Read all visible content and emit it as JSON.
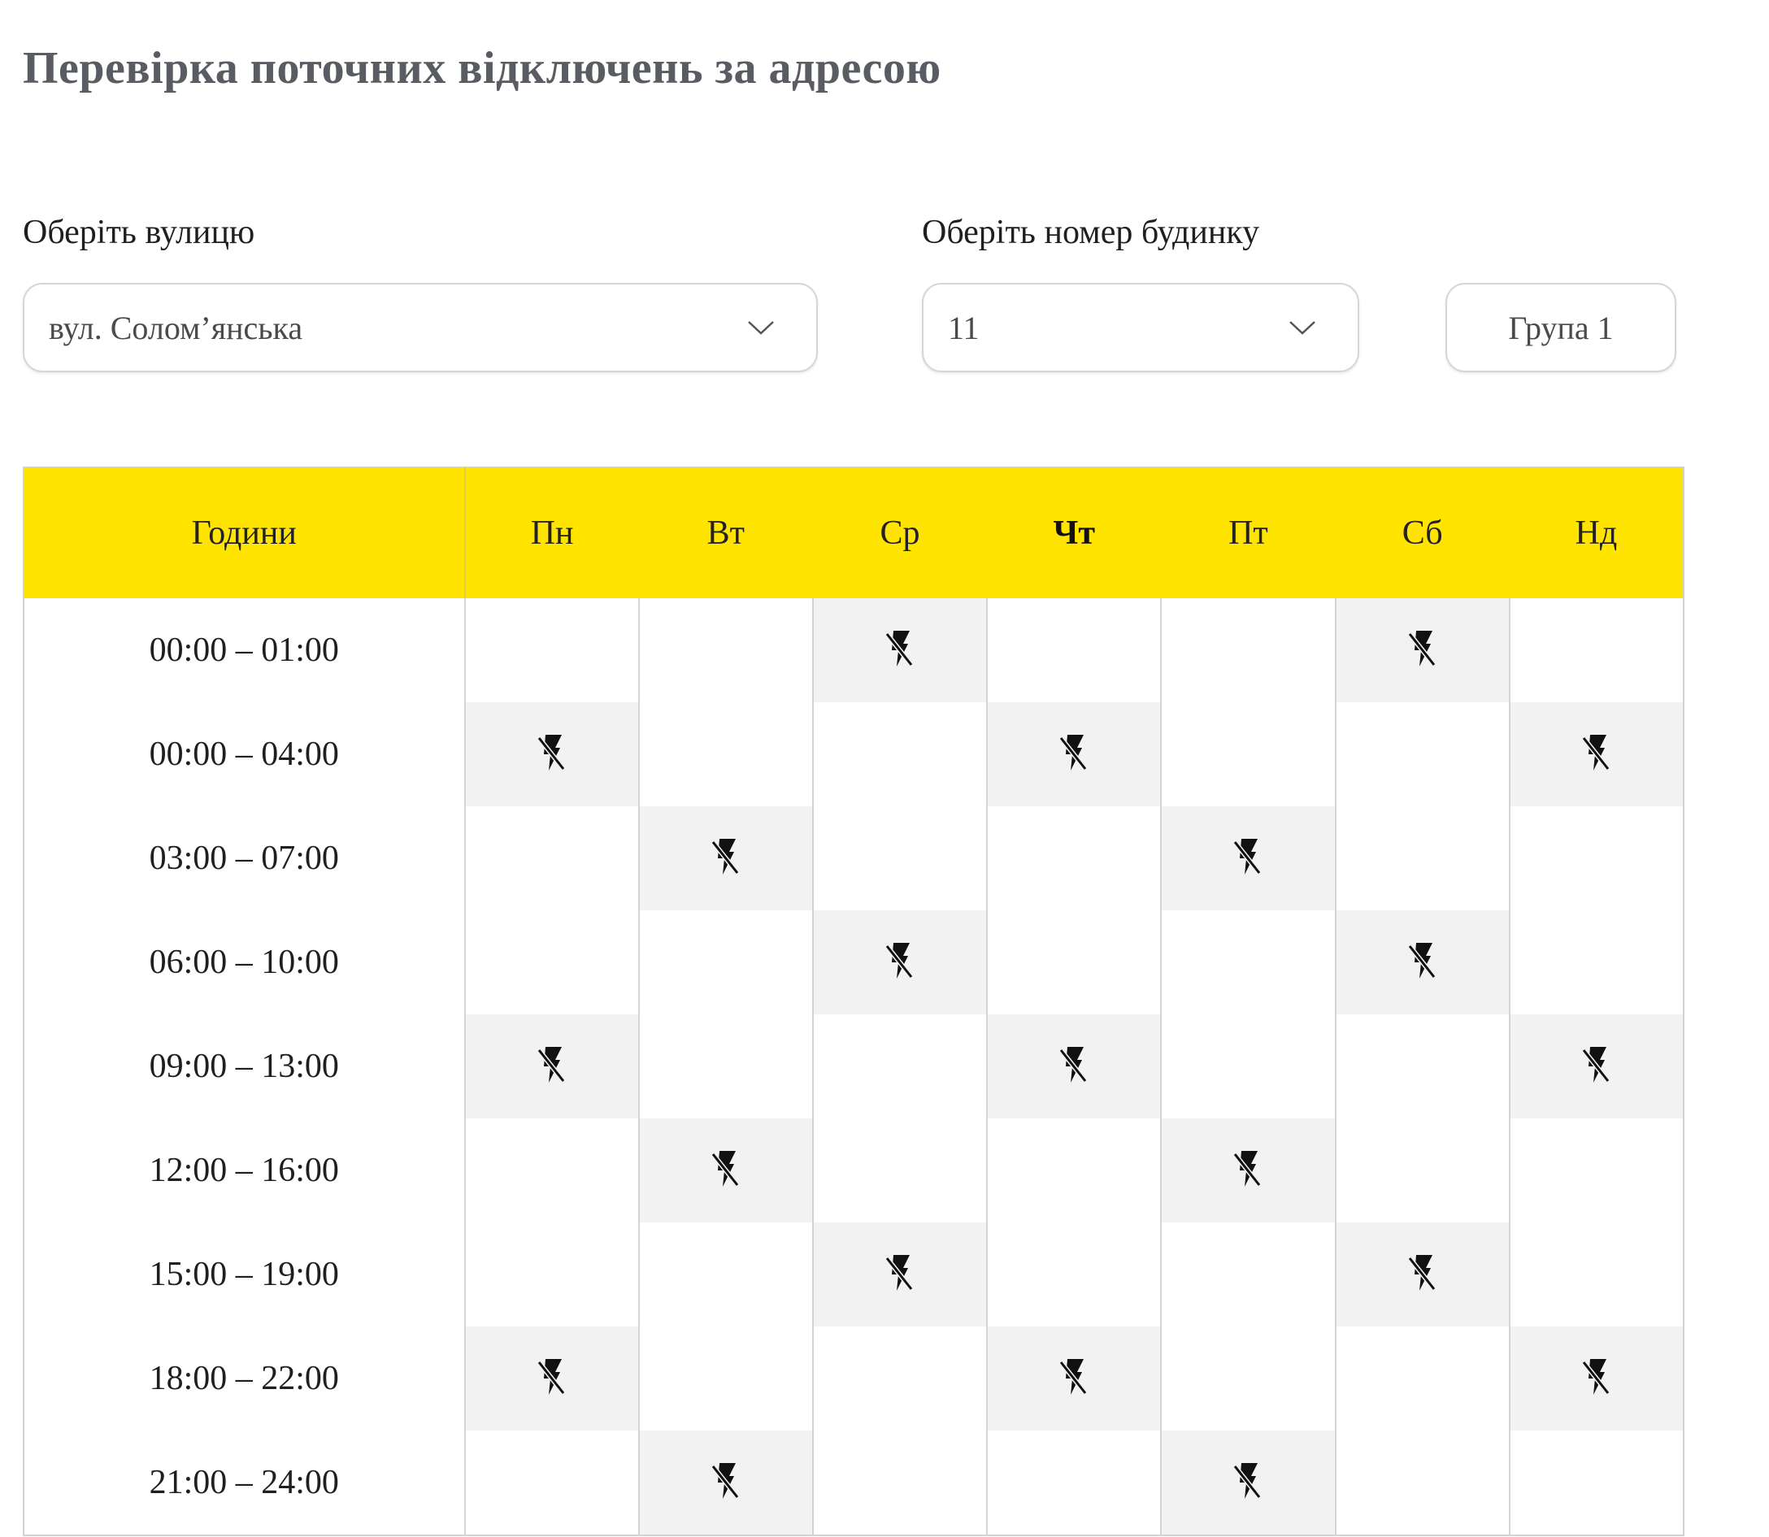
{
  "page": {
    "title": "Перевірка поточних відключень за адресою"
  },
  "street": {
    "label": "Оберіть вулицю",
    "value": "вул. Солом’янська",
    "icon": "chevron-down-icon"
  },
  "house": {
    "label": "Оберіть номер будинку",
    "value": "11",
    "icon": "chevron-down-icon"
  },
  "group": {
    "label": "Група 1"
  },
  "colors": {
    "header_bg": "#ffe400",
    "outage_cell_bg": "#f2f2f2",
    "title_color": "#5a5c63"
  },
  "schedule": {
    "hours_header": "Години",
    "days": [
      "Пн",
      "Вт",
      "Ср",
      "Чт",
      "Пт",
      "Сб",
      "Нд"
    ],
    "today_index": 3,
    "outage_icon": "no-power-lightning-icon",
    "rows": [
      {
        "hours": "00:00 – 01:00",
        "outages": [
          false,
          false,
          true,
          false,
          false,
          true,
          false
        ]
      },
      {
        "hours": "00:00 – 04:00",
        "outages": [
          true,
          false,
          false,
          true,
          false,
          false,
          true
        ]
      },
      {
        "hours": "03:00 – 07:00",
        "outages": [
          false,
          true,
          false,
          false,
          true,
          false,
          false
        ]
      },
      {
        "hours": "06:00 – 10:00",
        "outages": [
          false,
          false,
          true,
          false,
          false,
          true,
          false
        ]
      },
      {
        "hours": "09:00 – 13:00",
        "outages": [
          true,
          false,
          false,
          true,
          false,
          false,
          true
        ]
      },
      {
        "hours": "12:00 – 16:00",
        "outages": [
          false,
          true,
          false,
          false,
          true,
          false,
          false
        ]
      },
      {
        "hours": "15:00 – 19:00",
        "outages": [
          false,
          false,
          true,
          false,
          false,
          true,
          false
        ]
      },
      {
        "hours": "18:00 – 22:00",
        "outages": [
          true,
          false,
          false,
          true,
          false,
          false,
          true
        ]
      },
      {
        "hours": "21:00 – 24:00",
        "outages": [
          false,
          true,
          false,
          false,
          true,
          false,
          false
        ]
      }
    ]
  }
}
